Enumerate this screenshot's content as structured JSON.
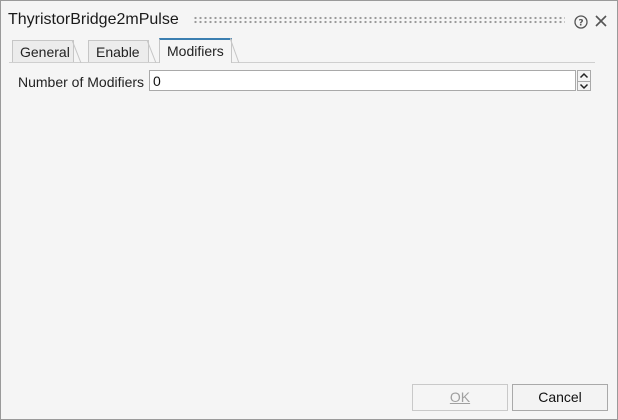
{
  "window": {
    "title": "ThyristorBridge2mPulse"
  },
  "tabs": [
    {
      "label": "General",
      "active": false
    },
    {
      "label": "Enable",
      "active": false
    },
    {
      "label": "Modifiers",
      "active": true
    }
  ],
  "form": {
    "number_of_modifiers_label": "Number of Modifiers",
    "number_of_modifiers_value": "0"
  },
  "buttons": {
    "ok_label": "OK",
    "cancel_label": "Cancel"
  },
  "colors": {
    "active_tab_accent": "#3c7fb1",
    "background": "#f5f5f5"
  }
}
